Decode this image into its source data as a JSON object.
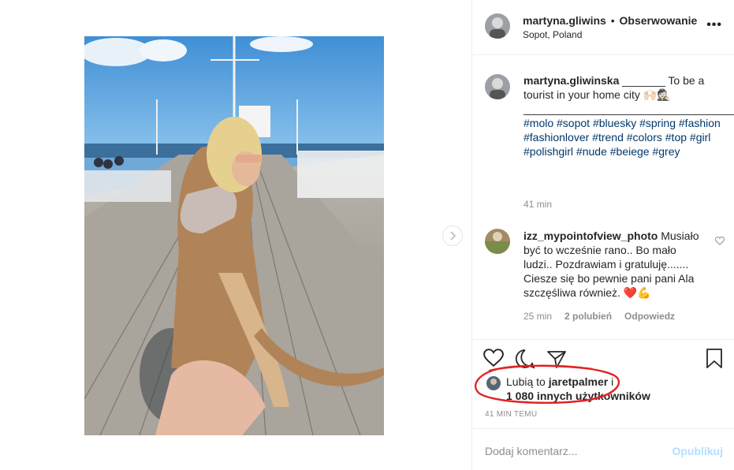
{
  "post_header": {
    "username": "martyna.gliwins",
    "separator": "•",
    "follow_status": "Obserwowanie",
    "location": "Sopot, Poland",
    "more_label": "•••"
  },
  "caption": {
    "username": "martyna.gliwinska",
    "text": " _______ To be a tourist in your home city 🙌🏻🕵🏻 _____________________________________",
    "hashtags": "#molo #sopot #bluesky #spring #fashion #fashionlover #trend #colors #top #girl #polishgirl #nude #beiege #grey",
    "time": "41 min"
  },
  "comment": {
    "username": "izz_mypointofview_photo",
    "text": " Musiało być to wcześnie rano.. Bo mało ludzi.. Pozdrawiam i gratuluję....... Ciesze się bo pewnie pani pani Ala szczęśliwa również. ❤️💪",
    "time": "25 min",
    "likes": "2 polubień",
    "reply_label": "Odpowiedz"
  },
  "likes": {
    "prefix": "Lubią to",
    "liker": "jaretpalmer",
    "conjunction": "i",
    "count_text": "1 080 innych użytkowników"
  },
  "timestamp": "41 MIN TEMU",
  "comment_box": {
    "placeholder": "Dodaj komentarz...",
    "publish_label": "Opublikuj"
  },
  "colors": {
    "annotation_circle": "#e02424",
    "link_blue": "#00376b",
    "publish_disabled": "#b2dffc"
  },
  "icons": [
    "heart-icon",
    "comment-icon",
    "share-icon",
    "bookmark-icon",
    "chevron-right-icon",
    "more-icon"
  ]
}
